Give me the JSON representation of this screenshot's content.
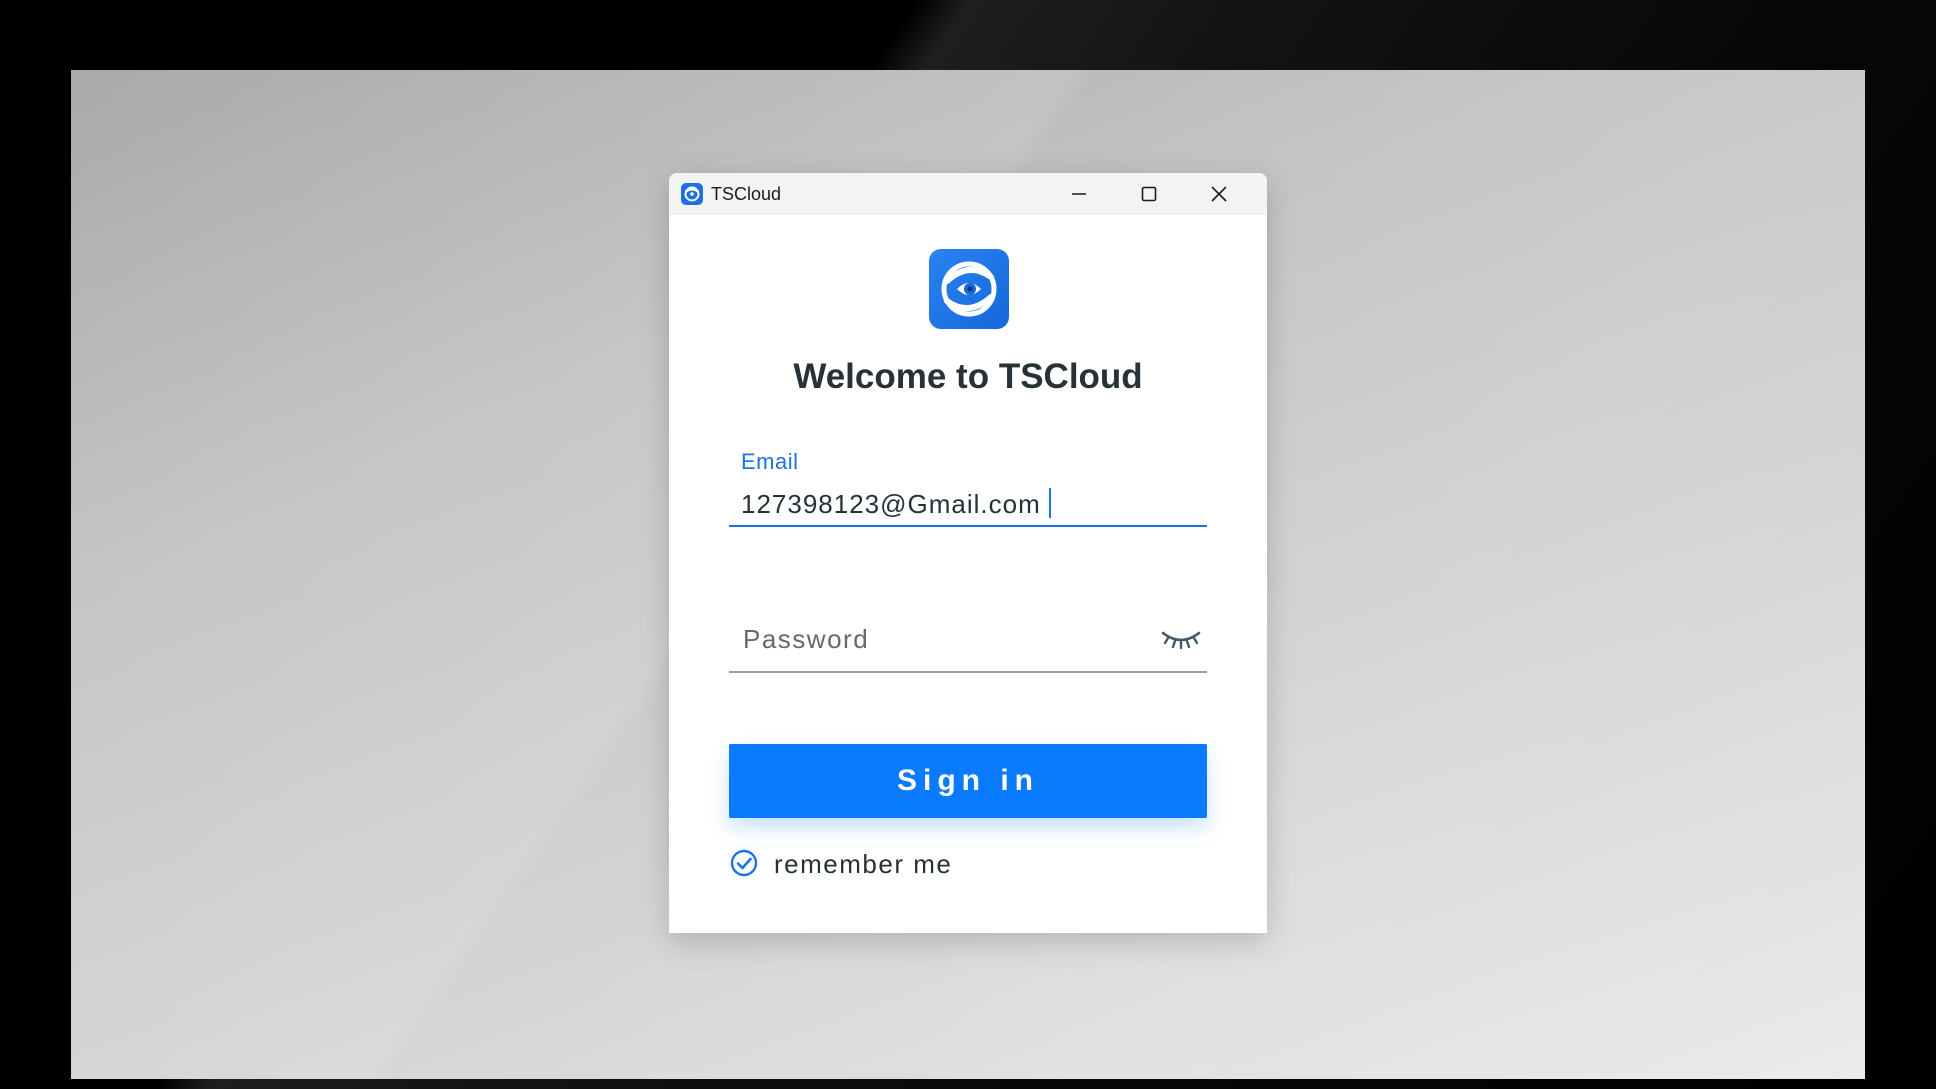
{
  "window": {
    "title": "TSCloud",
    "controls": {
      "minimize_icon": "minimize-icon",
      "maximize_icon": "maximize-icon",
      "close_icon": "close-icon"
    }
  },
  "login": {
    "logo_icon": "tscloud-logo-icon",
    "heading": "Welcome to TSCloud",
    "email": {
      "label": "Email",
      "value": "127398123@Gmail.com"
    },
    "password": {
      "placeholder": "Password",
      "value": "",
      "visibility_icon": "eye-closed-icon"
    },
    "sign_in_label": "Sign in",
    "remember_me": {
      "label": "remember me",
      "checked": true
    }
  },
  "colors": {
    "accent": "#0a7aff",
    "link_blue": "#1a73e8",
    "text_dark": "#263238"
  }
}
